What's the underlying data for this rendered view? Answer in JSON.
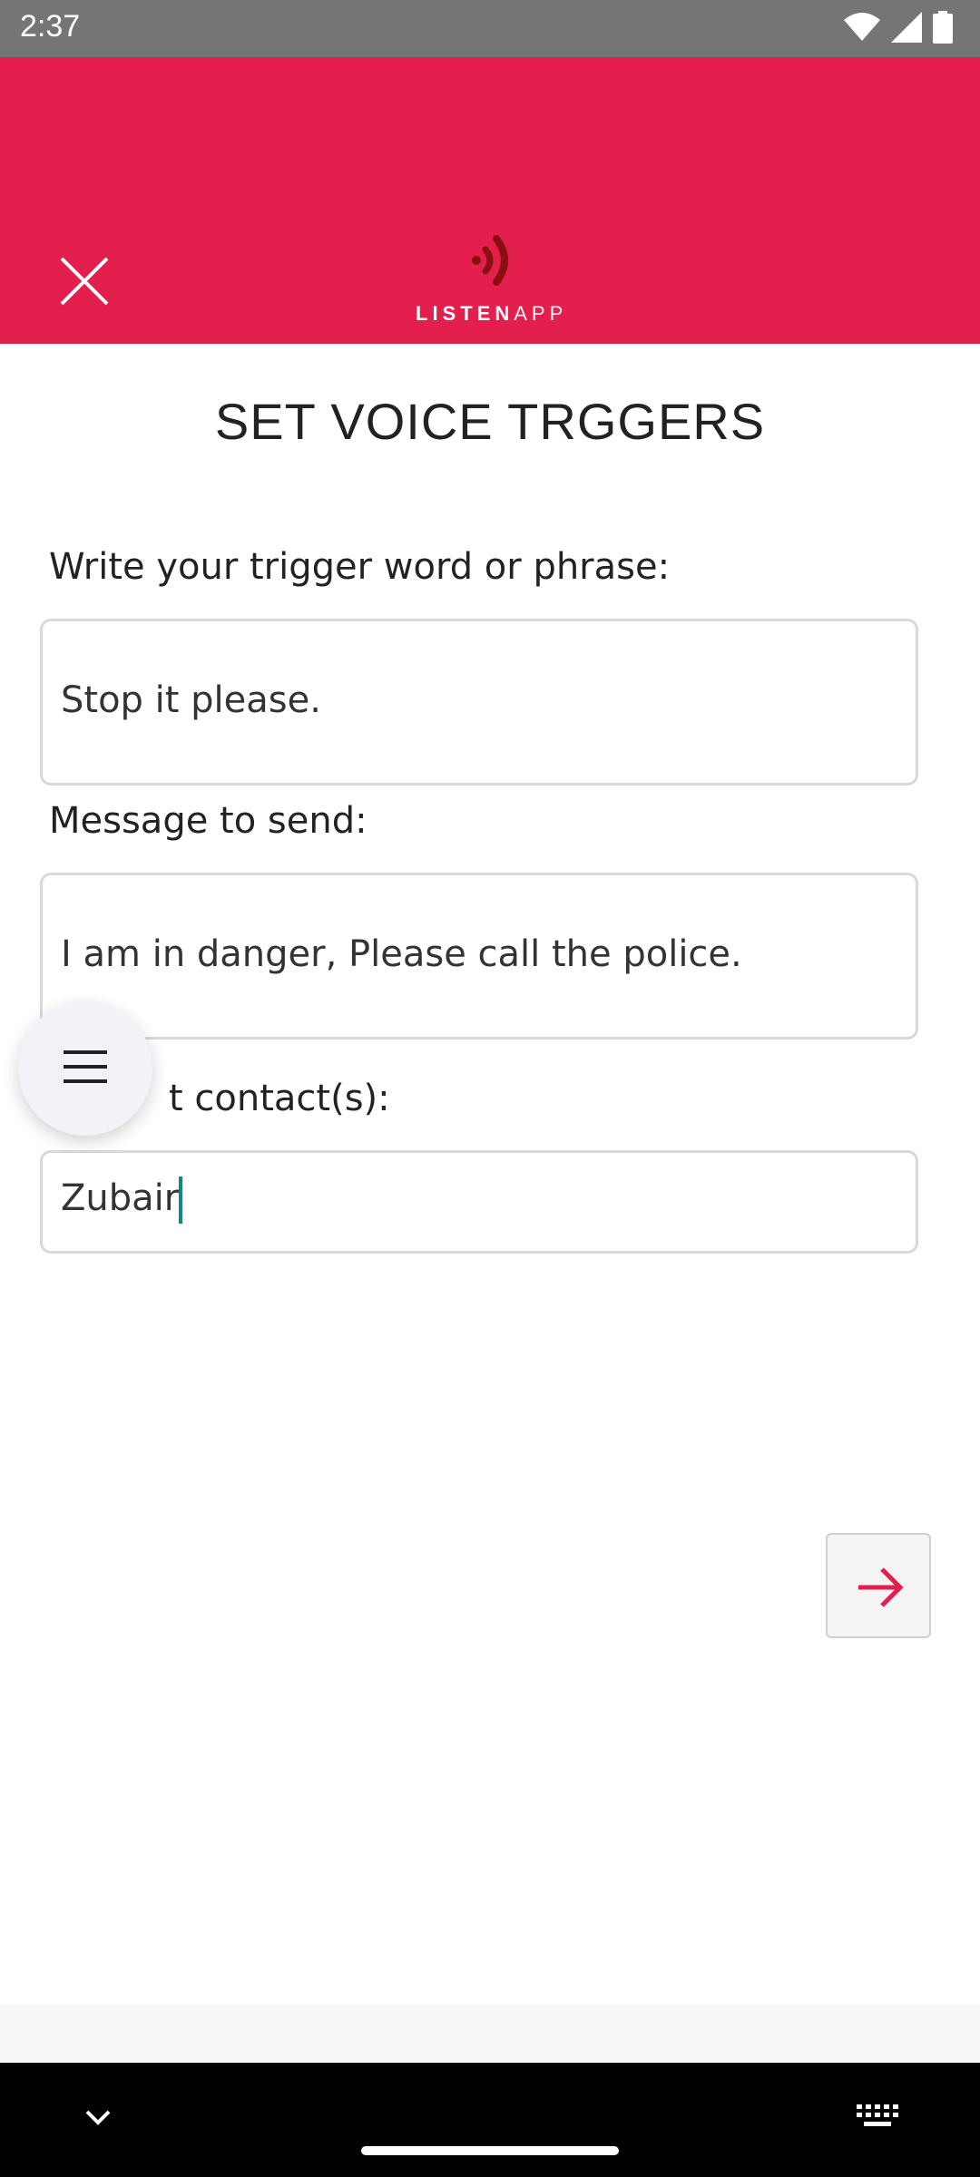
{
  "status_bar": {
    "time": "2:37",
    "icons": [
      "wifi-icon",
      "signal-icon",
      "battery-icon"
    ]
  },
  "header": {
    "close_icon": "close-icon",
    "logo": {
      "text_bold": "LISTEN",
      "text_light": "APP"
    },
    "brand_color": "#e21f4d"
  },
  "page": {
    "title": "SET VOICE TRGGERS"
  },
  "form": {
    "trigger": {
      "label": "Write your trigger word or phrase:",
      "value": "Stop it please."
    },
    "message": {
      "label": "Message to send:",
      "value": "I am in danger, Please call the police."
    },
    "contacts": {
      "label_visible": "t contact(s):",
      "value": "Zubair"
    }
  },
  "fab": {
    "icon": "menu-icon"
  },
  "next_button": {
    "icon": "arrow-right-icon",
    "color": "#e21f4d"
  },
  "nav_bar": {
    "left_icon": "chevron-down-icon",
    "right_icon": "keyboard-icon"
  }
}
